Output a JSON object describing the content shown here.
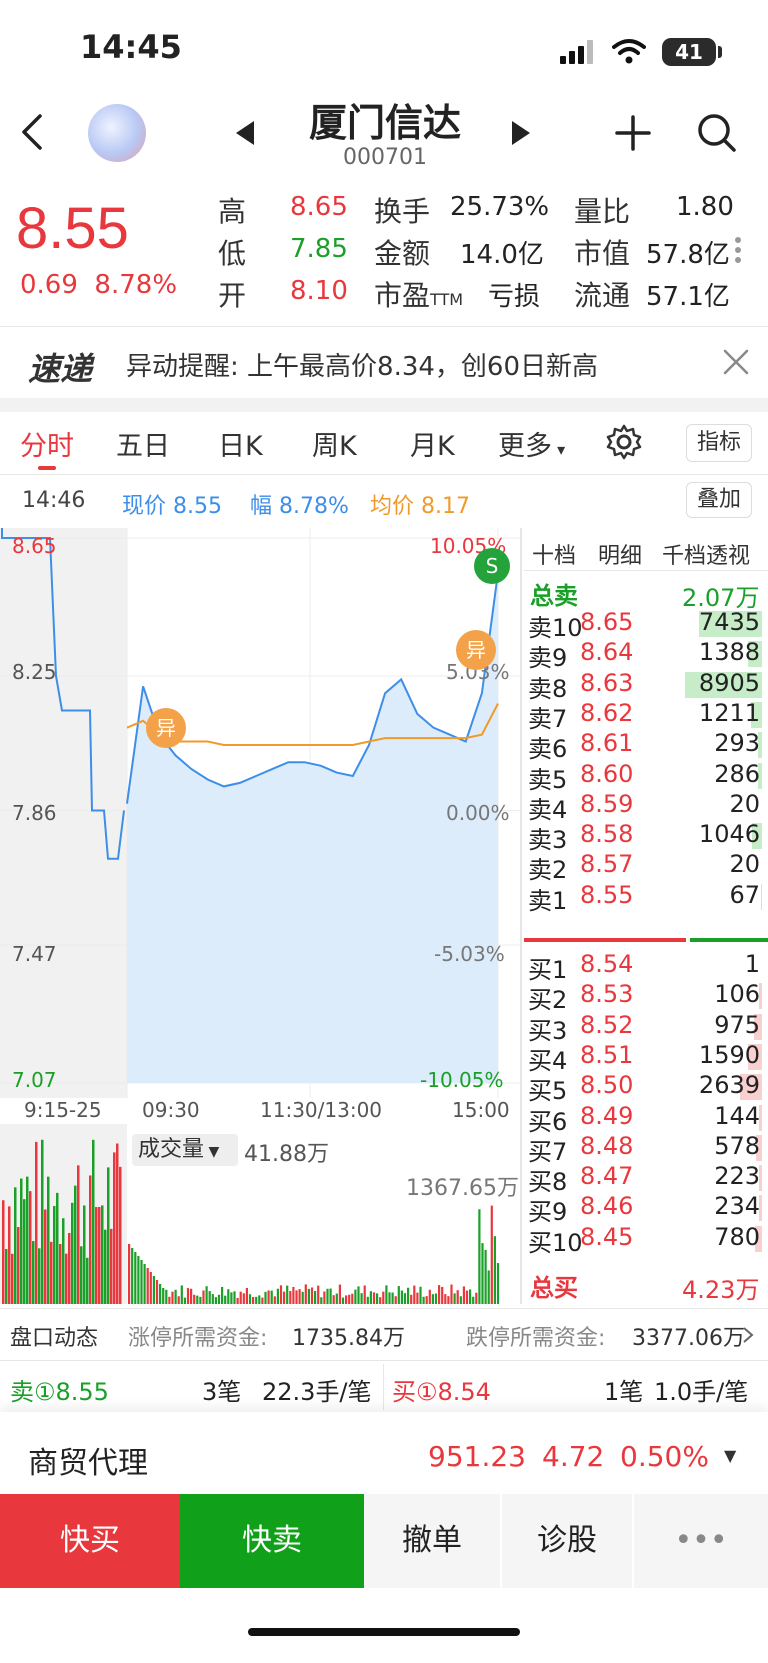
{
  "status_bar": {
    "time": "14:45",
    "battery": "41"
  },
  "header": {
    "name": "厦门信达",
    "code": "000701"
  },
  "quote": {
    "price": "8.55",
    "change": "0.69",
    "change_pct": "8.78%",
    "high_label": "高",
    "high": "8.65",
    "low_label": "低",
    "low": "7.85",
    "open_label": "开",
    "open": "8.10",
    "turnover_label": "换手",
    "turnover": "25.73%",
    "amount_label": "金额",
    "amount": "14.0亿",
    "pe_label": "市盈",
    "pe_sub": "TTM",
    "pe": "亏损",
    "vol_ratio_label": "量比",
    "vol_ratio": "1.80",
    "mktcap_label": "市值",
    "mktcap": "57.8亿",
    "float_label": "流通",
    "float_cap": "57.1亿"
  },
  "alert": {
    "logo": "速递",
    "text": "异动提醒: 上午最高价8.34，创60日新高"
  },
  "tabs": [
    "分时",
    "五日",
    "日K",
    "周K",
    "月K",
    "更多"
  ],
  "indicator_btn": "指标",
  "overlay_btn": "叠加",
  "info_line": {
    "time": "14:46",
    "price": "现价 8.55",
    "amp": "幅 8.78%",
    "avg": "均价 8.17"
  },
  "chart_data": {
    "type": "line",
    "price_axis": [
      "8.65",
      "8.25",
      "7.86",
      "7.47",
      "7.07"
    ],
    "pct_axis": [
      "10.05%",
      "5.03%",
      "0.00%",
      "-5.03%",
      "-10.05%"
    ],
    "time_axis": [
      "9:15-25",
      "09:30",
      "11:30/13:00",
      "15:00"
    ],
    "ylim": [
      7.07,
      8.65
    ],
    "prev_close": 7.86,
    "price_series": [
      7.88,
      8.22,
      8.08,
      8.02,
      7.98,
      7.95,
      7.93,
      7.94,
      7.96,
      7.98,
      8.0,
      8.0,
      7.99,
      7.97,
      7.96,
      8.05,
      8.2,
      8.24,
      8.14,
      8.1,
      8.08,
      8.06,
      8.2,
      8.55
    ],
    "avg_series": [
      8.1,
      8.12,
      8.08,
      8.06,
      8.06,
      8.06,
      8.05,
      8.05,
      8.05,
      8.05,
      8.05,
      8.05,
      8.05,
      8.05,
      8.05,
      8.06,
      8.07,
      8.07,
      8.07,
      8.07,
      8.07,
      8.07,
      8.08,
      8.17
    ],
    "markers": [
      "异",
      "异",
      "S"
    ]
  },
  "volume": {
    "label": "成交量",
    "value": "41.88万",
    "max": "1367.65万"
  },
  "orderbook": {
    "tabs": [
      "十档",
      "明细",
      "千档透视"
    ],
    "sell_total_label": "总卖",
    "sell_total": "2.07万",
    "buy_total_label": "总买",
    "buy_total": "4.23万",
    "asks": [
      {
        "label": "卖10",
        "price": "8.65",
        "vol": "7435",
        "bar": 0.45
      },
      {
        "label": "卖9",
        "price": "8.64",
        "vol": "1388",
        "bar": 0.1
      },
      {
        "label": "卖8",
        "price": "8.63",
        "vol": "8905",
        "bar": 0.55
      },
      {
        "label": "卖7",
        "price": "8.62",
        "vol": "1211",
        "bar": 0.08
      },
      {
        "label": "卖6",
        "price": "8.61",
        "vol": "293",
        "bar": 0.03
      },
      {
        "label": "卖5",
        "price": "8.60",
        "vol": "286",
        "bar": 0.03
      },
      {
        "label": "卖4",
        "price": "8.59",
        "vol": "20",
        "bar": 0.0
      },
      {
        "label": "卖3",
        "price": "8.58",
        "vol": "1046",
        "bar": 0.07
      },
      {
        "label": "卖2",
        "price": "8.57",
        "vol": "20",
        "bar": 0.0
      },
      {
        "label": "卖1",
        "price": "8.55",
        "vol": "67",
        "bar": 0.01
      }
    ],
    "bids": [
      {
        "label": "买1",
        "price": "8.54",
        "vol": "1",
        "bar": 0.0
      },
      {
        "label": "买2",
        "price": "8.53",
        "vol": "106",
        "bar": 0.02
      },
      {
        "label": "买3",
        "price": "8.52",
        "vol": "975",
        "bar": 0.06
      },
      {
        "label": "买4",
        "price": "8.51",
        "vol": "1590",
        "bar": 0.1
      },
      {
        "label": "买5",
        "price": "8.50",
        "vol": "2639",
        "bar": 0.16
      },
      {
        "label": "买6",
        "price": "8.49",
        "vol": "144",
        "bar": 0.02
      },
      {
        "label": "买7",
        "price": "8.48",
        "vol": "578",
        "bar": 0.04
      },
      {
        "label": "买8",
        "price": "8.47",
        "vol": "223",
        "bar": 0.02
      },
      {
        "label": "买9",
        "price": "8.46",
        "vol": "234",
        "bar": 0.02
      },
      {
        "label": "买10",
        "price": "8.45",
        "vol": "780",
        "bar": 0.05
      }
    ]
  },
  "flow": {
    "label": "盘口动态",
    "up_label": "涨停所需资金:",
    "up_value": "1735.84万",
    "down_label": "跌停所需资金:",
    "down_value": "3377.06万",
    "sell_info": "卖①8.55",
    "sell_count": "3笔",
    "sell_avg": "22.3手/笔",
    "buy_info": "买①8.54",
    "buy_count": "1笔",
    "buy_avg": "1.0手/笔"
  },
  "sector": {
    "name": "商贸代理",
    "value": "951.23",
    "change": "4.72",
    "pct": "0.50%"
  },
  "actions": {
    "quick_buy": "快买",
    "quick_sell": "快卖",
    "cancel": "撤单",
    "diagnose": "诊股",
    "more": "•••"
  },
  "colors": {
    "up": "#e8383d",
    "down": "#1aa028",
    "line": "#3d8ee8",
    "avg": "#f19a2a"
  }
}
